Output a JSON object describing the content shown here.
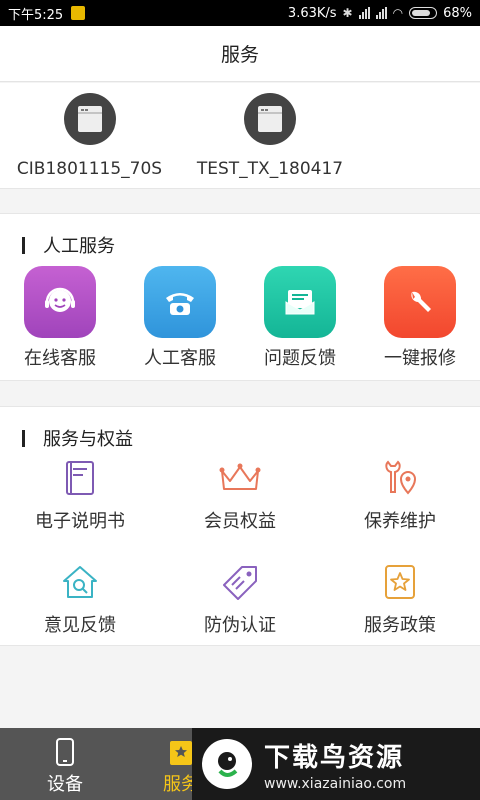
{
  "status_bar": {
    "time": "下午5:25",
    "speed": "3.63K/s",
    "battery": "68%"
  },
  "header": {
    "title": "服务"
  },
  "devices": [
    {
      "name": "CIB1801115_70S"
    },
    {
      "name": "TEST_TX_180417"
    }
  ],
  "human_service": {
    "title": "人工服务",
    "tiles": [
      {
        "label": "在线客服",
        "color": "#b455c6",
        "icon": "headset-icon"
      },
      {
        "label": "人工客服",
        "color": "#3ea6e6",
        "icon": "telephone-icon"
      },
      {
        "label": "问题反馈",
        "color": "#22c7a6",
        "icon": "mail-icon"
      },
      {
        "label": "一键报修",
        "color": "#ff5a3c",
        "icon": "wrench-icon"
      }
    ]
  },
  "service_rights": {
    "title": "服务与权益",
    "items": [
      {
        "label": "电子说明书",
        "icon": "manual-icon",
        "color": "#7e5ab3"
      },
      {
        "label": "会员权益",
        "icon": "crown-icon",
        "color": "#e8775a"
      },
      {
        "label": "保养维护",
        "icon": "maintenance-icon",
        "color": "#e8775a"
      },
      {
        "label": "意见反馈",
        "icon": "feedback-house-icon",
        "color": "#3ab3c4"
      },
      {
        "label": "防伪认证",
        "icon": "tag-icon",
        "color": "#8a62be"
      },
      {
        "label": "服务政策",
        "icon": "policy-star-icon",
        "color": "#e6a13a"
      }
    ]
  },
  "tab_bar": {
    "tabs": [
      {
        "label": "设备",
        "icon": "phone-icon",
        "color": "#ffffff"
      },
      {
        "label": "服务",
        "icon": "service-icon",
        "color": "#f5c518"
      }
    ]
  },
  "watermark": {
    "title": "下载鸟资源",
    "url": "www.xiazainiao.com"
  }
}
